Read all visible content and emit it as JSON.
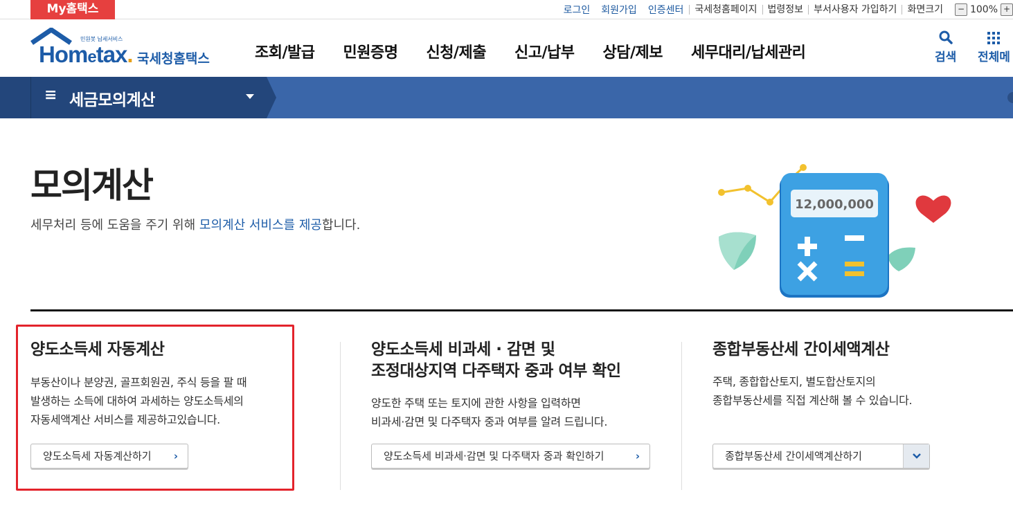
{
  "topbar": {
    "my_hometax": "My홈택스",
    "links_primary": [
      "로그인",
      "회원가입",
      "인증센터"
    ],
    "links_secondary": [
      "국세청홈페이지",
      "법령정보",
      "부서사용자 가입하기",
      "화면크기"
    ],
    "zoom_minus": "−",
    "zoom_value": "100%",
    "zoom_plus": "+"
  },
  "header": {
    "logo_small": "민원봇 납세서비스",
    "logo_word_hom": "Hom",
    "logo_word_e": "e",
    "logo_word_tax": "tax",
    "logo_word_dot": ".",
    "logo_korean": "국세청홈택스",
    "gnb": [
      "조회/발급",
      "민원증명",
      "신청/제출",
      "신고/납부",
      "상담/제보",
      "세무대리/납세관리"
    ],
    "search_label": "검색",
    "allmenu_label": "전체메"
  },
  "navbar": {
    "menu_icon": "≡",
    "title": "세금모의계산"
  },
  "hero": {
    "title": "모의계산",
    "desc_before": "세무처리 등에 도움을 주기 위해 ",
    "desc_highlight": "모의계산 서비스를 제공",
    "desc_after": "합니다.",
    "calc_display": "12,000,000"
  },
  "cards": [
    {
      "title_lines": [
        "양도소득세 자동계산"
      ],
      "desc_lines": [
        "부동산이나 분양권, 골프회원권, 주식 등을 팔 때",
        "발생하는 소득에 대하여 과세하는 양도소득세의",
        "자동세액계산 서비스를 제공하고있습니다."
      ],
      "button": "양도소득세 자동계산하기"
    },
    {
      "title_lines": [
        "양도소득세 비과세 · 감면 및",
        "조정대상지역 다주택자 중과 여부 확인"
      ],
      "desc_lines": [
        "양도한 주택 또는 토지에 관한 사항을 입력하면",
        "비과세·감면 및 다주택자 중과 여부를 알려 드립니다."
      ],
      "button": "양도소득세 비과세·감면 및 다주택자 중과 확인하기"
    },
    {
      "title_lines": [
        "종합부동산세 간이세액계산"
      ],
      "desc_lines": [
        "주택, 종합합산토지, 별도합산토지의",
        "종합부동산세를 직접 계산해 볼 수 있습니다."
      ],
      "button": "종합부동산세 간이세액계산하기"
    }
  ],
  "colors": {
    "brand_blue": "#1d5ca8",
    "nav_dark": "#23467b",
    "nav_blue": "#3a66a9",
    "highlight_red": "#e3232b"
  }
}
